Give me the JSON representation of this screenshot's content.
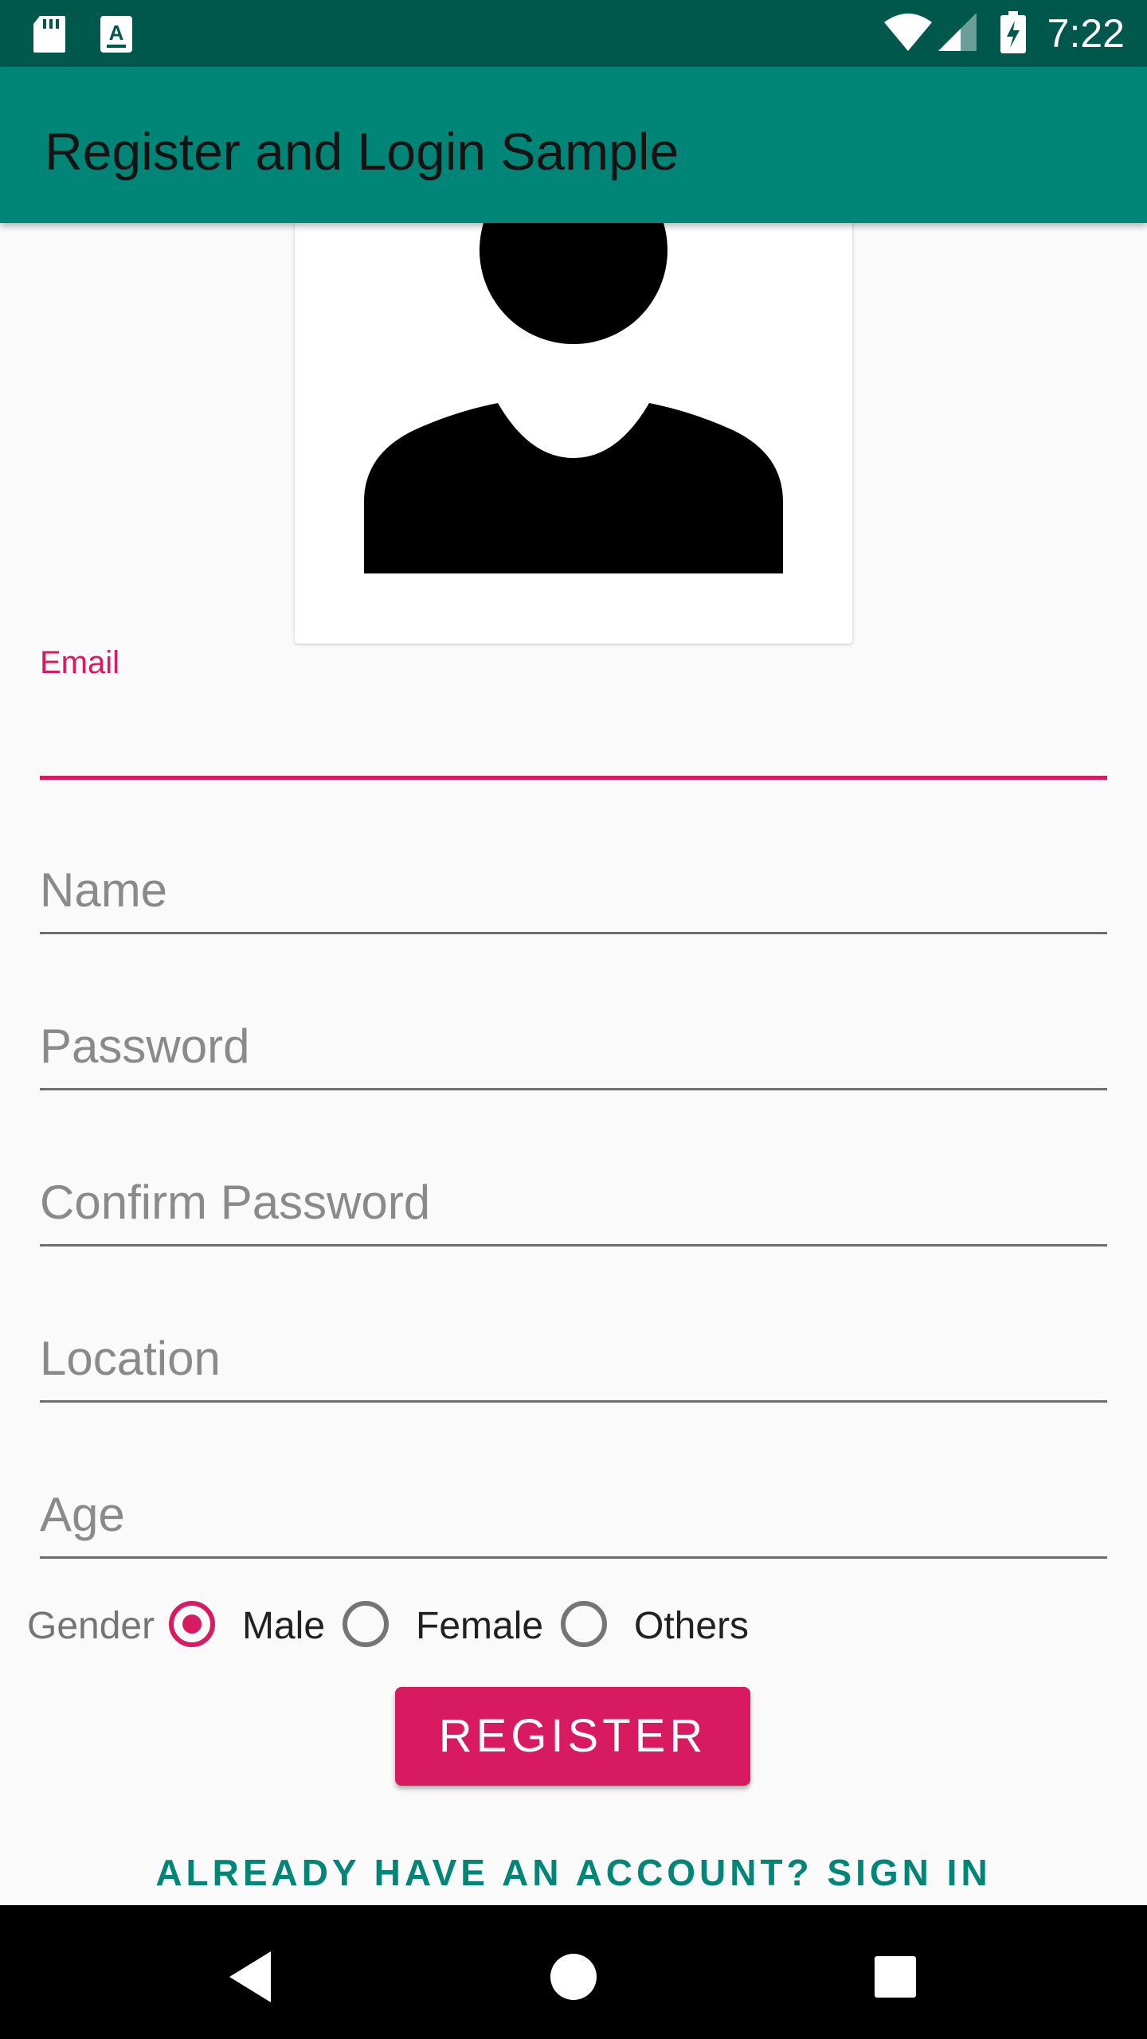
{
  "status_bar": {
    "time": "7:22",
    "icons": [
      "sd-card-icon",
      "text-format-icon",
      "wifi-icon",
      "cellular-signal-icon",
      "battery-charging-icon"
    ]
  },
  "app_bar": {
    "title": "Register and Login Sample",
    "color": "#008577"
  },
  "avatar": {
    "icon": "person-avatar-icon"
  },
  "form": {
    "email": {
      "label": "Email",
      "value": "",
      "focused": true
    },
    "name": {
      "placeholder": "Name",
      "value": ""
    },
    "password": {
      "placeholder": "Password",
      "value": ""
    },
    "confirm_password": {
      "placeholder": "Confirm Password",
      "value": ""
    },
    "location": {
      "placeholder": "Location",
      "value": ""
    },
    "age": {
      "placeholder": "Age",
      "value": ""
    },
    "gender": {
      "label": "Gender",
      "options": [
        "Male",
        "Female",
        "Others"
      ],
      "selected": "Male"
    }
  },
  "actions": {
    "register_label": "REGISTER",
    "signin_label": "ALREADY HAVE AN ACCOUNT? SIGN IN"
  },
  "colors": {
    "accent": "#d81b60",
    "primary": "#008577",
    "primary_dark": "#00574b"
  },
  "nav_bar": {
    "icons": [
      "back-icon",
      "home-icon",
      "recents-icon"
    ]
  }
}
